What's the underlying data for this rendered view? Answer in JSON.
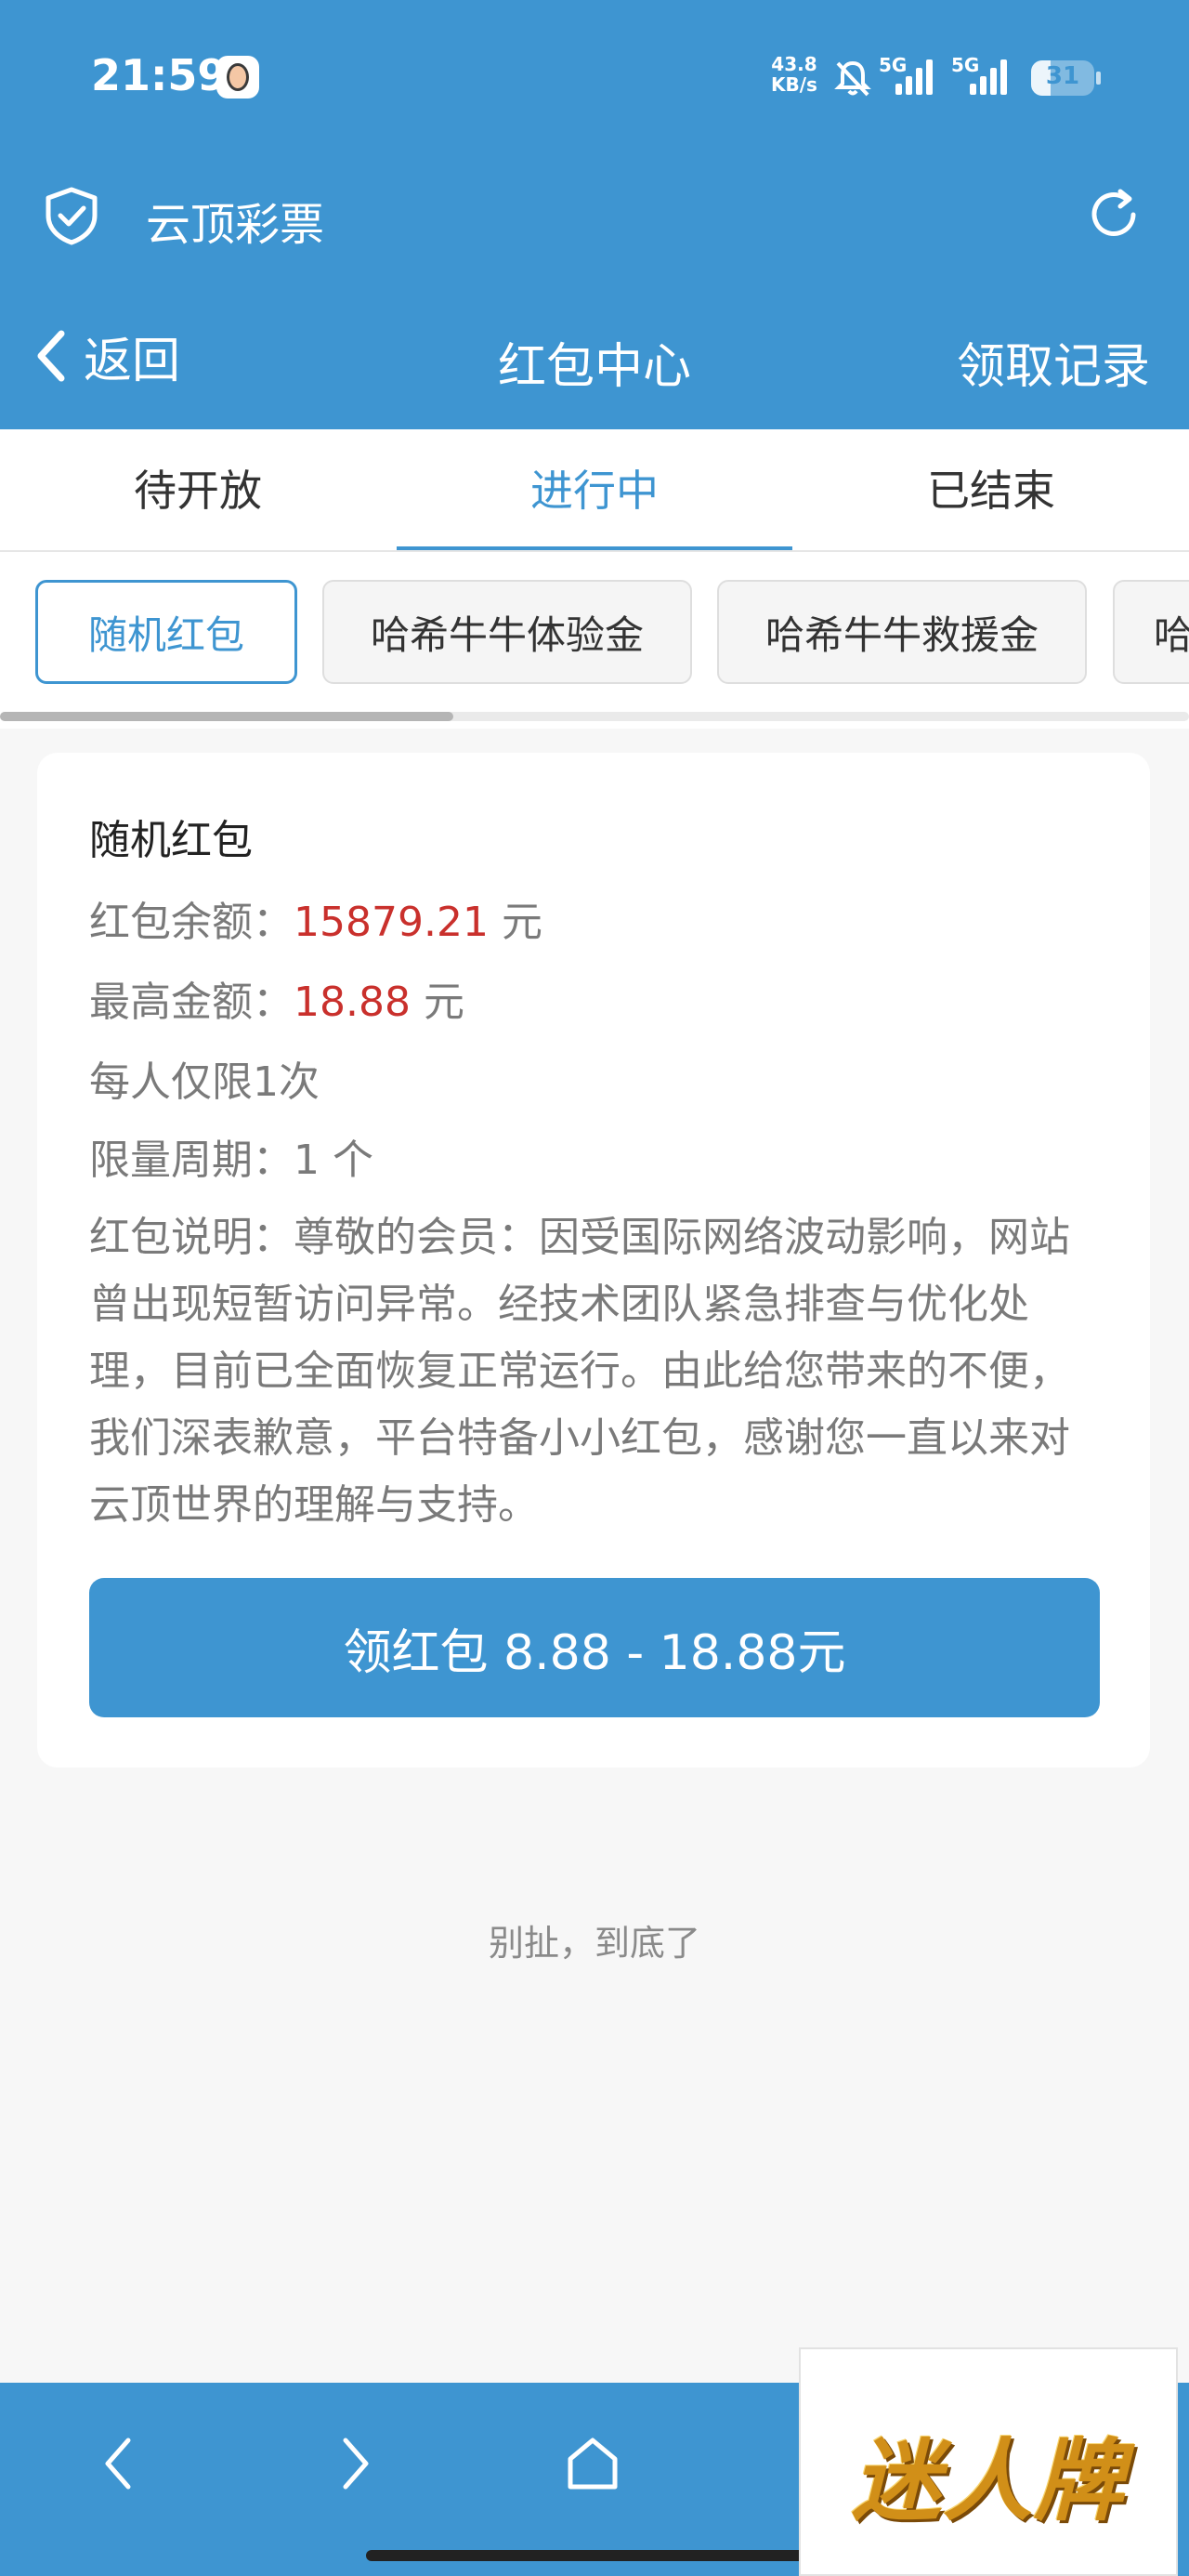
{
  "status_bar": {
    "time": "21:59",
    "net_speed_value": "43.8",
    "net_speed_unit": "KB/s",
    "sim1_label": "5G",
    "sim2_label": "5G",
    "battery": "31",
    "battery_level": 0.31
  },
  "app_bar": {
    "title": "云顶彩票"
  },
  "nav_bar": {
    "back_label": "返回",
    "title": "红包中心",
    "record_label": "领取记录"
  },
  "tabs": [
    {
      "label": "待开放"
    },
    {
      "label": "进行中"
    },
    {
      "label": "已结束"
    }
  ],
  "chips": [
    {
      "label": "随机红包"
    },
    {
      "label": "哈希牛牛体验金"
    },
    {
      "label": "哈希牛牛救援金"
    },
    {
      "label": "哈"
    }
  ],
  "card": {
    "title": "随机红包",
    "balance_label": "红包余额：",
    "balance_value": "15879.21",
    "balance_unit": " 元",
    "max_label": "最高金额：",
    "max_value": "18.88",
    "max_unit": " 元",
    "limit_text": "每人仅限1次",
    "period_text": "限量周期：1 个",
    "description": "红包说明：尊敬的会员：因受国际网络波动影响，网站曾出现短暂访问异常。经技术团队紧急排查与优化处理，目前已全面恢复正常运行。由此给您带来的不便，我们深表歉意，平台特备小小红包，感谢您一直以来对云顶世界的理解与支持。",
    "button_label": "领红包 8.88 - 18.88元"
  },
  "footer_text": "别扯，到底了",
  "watermark": "迷人牌",
  "colors": {
    "primary": "#3e95d1",
    "amount_red": "#c9302c"
  }
}
